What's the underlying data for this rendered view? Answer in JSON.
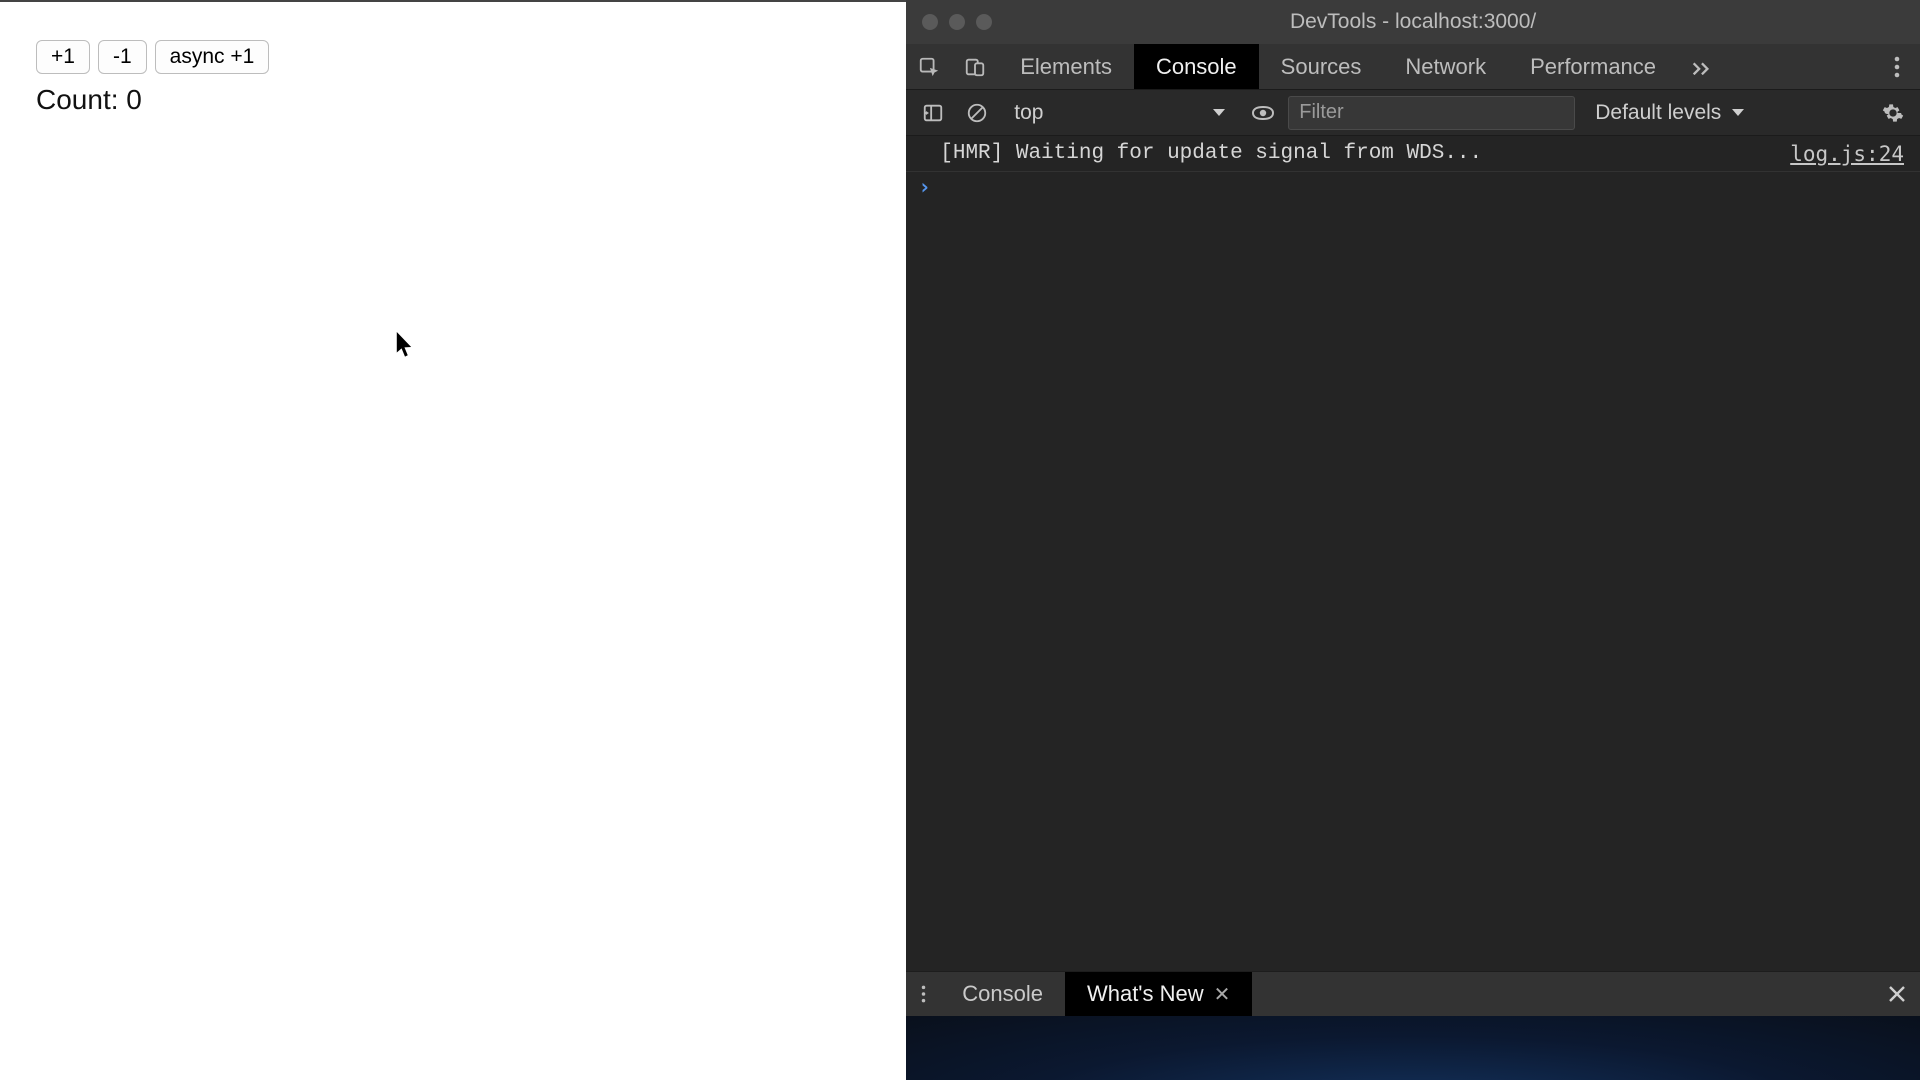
{
  "app": {
    "buttons": {
      "inc": "+1",
      "dec": "-1",
      "async": "async +1"
    },
    "count_label": "Count: ",
    "count_value": "0"
  },
  "devtools": {
    "title": "DevTools - localhost:3000/",
    "tabs": [
      "Elements",
      "Console",
      "Sources",
      "Network",
      "Performance"
    ],
    "active_tab": "Console",
    "console_toolbar": {
      "context": "top",
      "filter_placeholder": "Filter",
      "levels": "Default levels"
    },
    "log": {
      "message": "[HMR] Waiting for update signal from WDS...",
      "source": "log.js:24"
    },
    "drawer": {
      "tabs": [
        "Console",
        "What's New"
      ],
      "active": "What's New"
    }
  }
}
